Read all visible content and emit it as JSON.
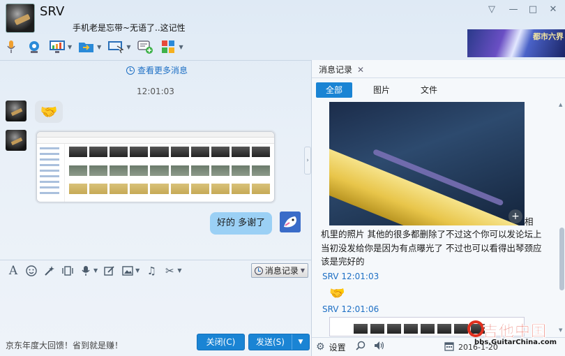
{
  "header": {
    "contact_name": "SRV",
    "signature": "手机老是忘带~无语了..这记性",
    "window_controls": {
      "menu": "▽",
      "minimize": "—",
      "maximize": "□",
      "close": "✕"
    },
    "banner_text": "都市六界"
  },
  "toolbar": {
    "items": [
      {
        "name": "voice-call-icon"
      },
      {
        "name": "video-call-icon"
      },
      {
        "name": "remote-desktop-icon"
      },
      {
        "name": "send-file-icon"
      },
      {
        "name": "screen-share-icon"
      },
      {
        "name": "create-group-icon"
      },
      {
        "name": "apps-icon"
      }
    ]
  },
  "chat": {
    "view_more": "查看更多消息",
    "timestamp": "12:01:03",
    "outgoing_text": "好的 多谢了"
  },
  "input_toolbar": {
    "message_record_label": "消息记录"
  },
  "footer": {
    "promo": "京东年度大回馈！省到就是赚！",
    "close_label": "关闭(C)",
    "send_label": "发送(S)"
  },
  "history": {
    "tab_label": "消息记录",
    "filters": [
      "全部",
      "图片",
      "文件"
    ],
    "message_text_lead": "相",
    "message_text": "机里的照片 其他的很多都删除了不过这个你可以发论坛上 当初没发给你是因为有点曝光了 不过也可以看得出琴颈应该是完好的",
    "entry1_meta": "SRV  12:01:03",
    "entry2_meta": "SRV  12:01:06",
    "settings_label": "设置",
    "date": "2016-1-20"
  },
  "watermark": {
    "title": "吉他中国",
    "url": "bbs.GuitarChina.com"
  },
  "colors": {
    "accent": "#1a84d4",
    "link": "#1d6fc4",
    "outgoing_bubble": "#9bd0f5",
    "incoming_bubble": "#dfe5ec"
  }
}
